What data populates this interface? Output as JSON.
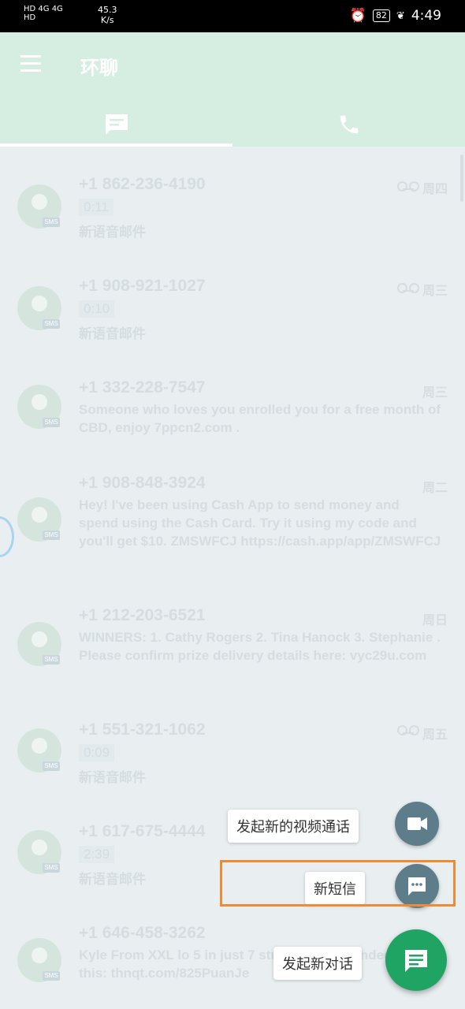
{
  "status_bar": {
    "left_line1": "HD 4G 4G",
    "left_line2": "HD",
    "speed_value": "45.3",
    "speed_unit": "K/s",
    "battery": "82",
    "time": "4:49"
  },
  "app_bar": {
    "title": "环聊"
  },
  "conversations": [
    {
      "phone": "+1 862-236-4190",
      "day": "周四",
      "voicemail": true,
      "duration": "0:11",
      "subtitle": "新语音邮件"
    },
    {
      "phone": "+1 908-921-1027",
      "day": "周三",
      "voicemail": true,
      "duration": "0:10",
      "subtitle": "新语音邮件"
    },
    {
      "phone": "+1 332-228-7547",
      "day": "周三",
      "message": "Someone who loves you enrolled you for a free month of CBD, enjoy 7ppcn2.com ."
    },
    {
      "phone": "+1 908-848-3924",
      "day": "周二",
      "message": "Hey! I've been using Cash App to send money and spend using the Cash Card. Try it using my code and you'll get $10. ZMSWFCJ https://cash.app/app/ZMSWFCJ"
    },
    {
      "phone": "+1 212-203-6521",
      "day": "周日",
      "message": "WINNERS: 1. Cathy Rogers 2. Tina Hanock 3. Stephanie . Please confirm prize delivery details here: vyc29u.com"
    },
    {
      "phone": "+1 551-321-1062",
      "day": "周五",
      "voicemail": true,
      "duration": "0:09",
      "subtitle": "新语音邮件"
    },
    {
      "phone": "+1 617-675-4444",
      "duration": "2:39",
      "subtitle": "新语音邮件"
    },
    {
      "phone": "+1 646-458-3262",
      "message": "Kyle From XXL lo 5 in just 7 stuff! Recommended by Sh this: thnqt.com/825PuanJe"
    }
  ],
  "avatar_badge": "SMS",
  "speed_dial": {
    "video_call_label": "发起新的视频通话",
    "new_sms_label": "新短信",
    "new_conversation_label": "发起新对话"
  },
  "colors": {
    "app_bar": "#d6ede2",
    "list_bg": "#e9eef0",
    "fab_main": "#1fa463",
    "fab_mini": "#5e7d8a",
    "highlight": "#f08a35"
  }
}
